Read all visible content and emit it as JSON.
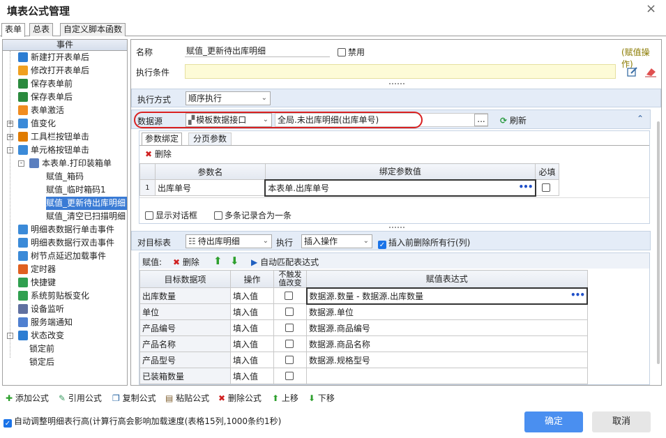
{
  "window": {
    "title": "填表公式管理",
    "close": "×"
  },
  "tabs": [
    "表单",
    "总表",
    "自定义脚本函数"
  ],
  "left": {
    "header": "事件",
    "items": [
      {
        "label": "新建打开表单后",
        "color": "#2d7dd2"
      },
      {
        "label": "修改打开表单后",
        "color": "#f0a020"
      },
      {
        "label": "保存表单前",
        "color": "#2b8a3e"
      },
      {
        "label": "保存表单后",
        "color": "#2b8a3e"
      },
      {
        "label": "表单激活",
        "color": "#f08c20"
      },
      {
        "label": "值变化",
        "color": "#3b8ad8"
      },
      {
        "label": "工具栏按钮单击",
        "color": "#e07b00"
      },
      {
        "label": "单元格按钮单击",
        "color": "#3b8ad8"
      },
      {
        "label": "本表单.打印装箱单",
        "color": "#5b7fbf"
      },
      {
        "label": "赋值_箱码",
        "color": ""
      },
      {
        "label": "赋值_临时箱码1",
        "color": ""
      },
      {
        "label": "赋值_更新待出库明细",
        "color": ""
      },
      {
        "label": "赋值_清空已扫描明细",
        "color": ""
      },
      {
        "label": "明细表数据行单击事件",
        "color": "#3b8ad8"
      },
      {
        "label": "明细表数据行双击事件",
        "color": "#3b8ad8"
      },
      {
        "label": "树节点延迟加载事件",
        "color": "#3b8ad8"
      },
      {
        "label": "定时器",
        "color": "#e06020"
      },
      {
        "label": "快捷键",
        "color": "#30a050"
      },
      {
        "label": "系统剪贴板变化",
        "color": "#30a050"
      },
      {
        "label": "设备监听",
        "color": "#6070a0"
      },
      {
        "label": "服务端通知",
        "color": "#5080d0"
      },
      {
        "label": "状态改变",
        "color": "#2d7dd2"
      },
      {
        "label": "锁定前",
        "color": ""
      },
      {
        "label": "锁定后",
        "color": ""
      }
    ]
  },
  "form": {
    "name_label": "名称",
    "name_value": "赋值_更新待出库明细",
    "disable_label": "禁用",
    "action_tag": "(赋值操作)",
    "cond_label": "执行条件",
    "exec_label": "执行方式",
    "exec_value": "顺序执行",
    "ds_label": "数据源",
    "ds_type": "模板数据接口",
    "ds_value": "全局.未出库明细(出库单号)",
    "ellipsis": "...",
    "refresh": "刷新"
  },
  "params": {
    "tab1": "参数绑定",
    "tab2": "分页参数",
    "delete": "删除",
    "headers": [
      "参数名",
      "绑定参数值",
      "必填"
    ],
    "rows": [
      {
        "n": "1",
        "name": "出库单号",
        "value": "本表单.出库单号"
      }
    ],
    "show_dialog": "显示对话框",
    "merge": "多条记录合为一条"
  },
  "target": {
    "label": "对目标表",
    "table": "待出库明细",
    "exec_label": "执行",
    "op": "插入操作",
    "clear": "插入前删除所有行(列)",
    "assign_label": "赋值:",
    "delete": "删除",
    "auto": "自动匹配表达式",
    "headers": [
      "目标数据项",
      "操作",
      "不触发值改变",
      "赋值表达式"
    ],
    "rows": [
      {
        "item": "出库数量",
        "op": "填入值",
        "expr": "数据源.数量 - 数据源.出库数量"
      },
      {
        "item": "单位",
        "op": "填入值",
        "expr": "数据源.单位"
      },
      {
        "item": "产品编号",
        "op": "填入值",
        "expr": "数据源.商品编号"
      },
      {
        "item": "产品名称",
        "op": "填入值",
        "expr": "数据源.商品名称"
      },
      {
        "item": "产品型号",
        "op": "填入值",
        "expr": "数据源.规格型号"
      },
      {
        "item": "已装箱数量",
        "op": "填入值",
        "expr": ""
      }
    ]
  },
  "bottom": {
    "add": "添加公式",
    "ref": "引用公式",
    "copy": "复制公式",
    "paste": "粘贴公式",
    "del": "删除公式",
    "up": "上移",
    "down": "下移",
    "auto_adjust": "自动调整明细表行高(计算行高会影响加载速度(表格15列,1000条约1秒)",
    "ok": "确定",
    "cancel": "取消"
  }
}
